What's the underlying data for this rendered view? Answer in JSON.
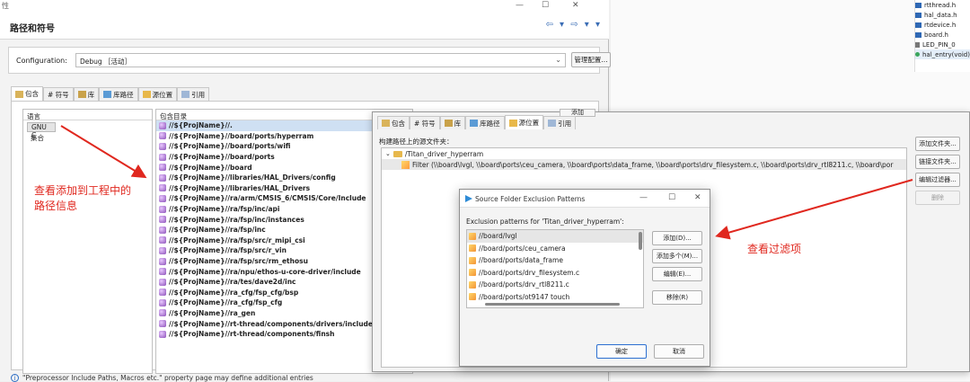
{
  "main_window": {
    "title_fragment": "性",
    "page_title": "路径和符号",
    "nav": "⇦ ▾ ⇨ ▾ ▾",
    "window_buttons": {
      "minimize": "—",
      "maximize": "☐",
      "close": "✕"
    }
  },
  "configuration": {
    "label": "Configuration:",
    "value": "Debug ［活动］",
    "manage_button": "管理配置..."
  },
  "main_tabs": [
    {
      "label": "包含",
      "icon": "include-icon",
      "active": true
    },
    {
      "label": "# 符号",
      "icon": "symbol-icon"
    },
    {
      "label": "库",
      "icon": "library-icon"
    },
    {
      "label": "库路径",
      "icon": "library-path-icon"
    },
    {
      "label": "源位置",
      "icon": "source-location-icon"
    },
    {
      "label": "引用",
      "icon": "reference-icon"
    }
  ],
  "language_panel": {
    "header": "语言",
    "items": [
      "GNU C",
      "集合"
    ]
  },
  "include_panel": {
    "header": "包含目录",
    "rows": [
      "//${ProjName}//.",
      "//${ProjName}//board/ports/hyperram",
      "//${ProjName}//board/ports/wifi",
      "//${ProjName}//board/ports",
      "//${ProjName}//board",
      "//${ProjName}//libraries/HAL_Drivers/config",
      "//${ProjName}//libraries/HAL_Drivers",
      "//${ProjName}//ra/arm/CMSIS_6/CMSIS/Core/Include",
      "//${ProjName}//ra/fsp/inc/api",
      "//${ProjName}//ra/fsp/inc/instances",
      "//${ProjName}//ra/fsp/inc",
      "//${ProjName}//ra/fsp/src/r_mipi_csi",
      "//${ProjName}//ra/fsp/src/r_vin",
      "//${ProjName}//ra/fsp/src/rm_ethosu",
      "//${ProjName}//ra/npu/ethos-u-core-driver/include",
      "//${ProjName}//ra/tes/dave2d/inc",
      "//${ProjName}//ra_cfg/fsp_cfg/bsp",
      "//${ProjName}//ra_cfg/fsp_cfg",
      "//${ProjName}//ra_gen",
      "//${ProjName}//rt-thread/components/drivers/include",
      "//${ProjName}//rt-thread/components/finsh"
    ],
    "add_button_partial": "添加"
  },
  "annotation_left": "查看添加到工程中的路径信息",
  "status_line": "\"Preprocessor Include Paths, Macros etc.\" property page may define additional entries",
  "outline": {
    "items": [
      "rtthread.h",
      "hal_data.h",
      "rtdevice.h",
      "board.h",
      "LED_PIN_0",
      "hal_entry(void)"
    ]
  },
  "props_window": {
    "tabs": [
      "包含",
      "# 符号",
      "库",
      "库路径",
      "源位置",
      "引用"
    ],
    "source_label": "构建路径上的源文件夹：",
    "folder": "/Titan_driver_hyperram",
    "filter": "Filter (\\\\board\\lvgl, \\\\board\\ports\\ceu_camera, \\\\board\\ports\\data_frame, \\\\board\\ports\\drv_filesystem.c, \\\\board\\ports\\drv_rtl8211.c, \\\\board\\por",
    "buttons": [
      "添加文件夹...",
      "链接文件夹...",
      "编辑过滤器...",
      "删除"
    ]
  },
  "annotation_right": "查看过滤项",
  "dialog": {
    "title": "Source Folder Exclusion Patterns",
    "description": "Exclusion patterns for 'Titan_driver_hyperram':",
    "patterns": [
      "//board/lvgl",
      "//board/ports/ceu_camera",
      "//board/ports/data_frame",
      "//board/ports/drv_filesystem.c",
      "//board/ports/drv_rtl8211.c",
      "//board/ports/ot9147 touch"
    ],
    "side_buttons": [
      "添加(D)...",
      "添加多个(M)...",
      "编辑(E)...",
      "移除(R)"
    ],
    "ok": "确定",
    "cancel": "取消"
  },
  "colors": {
    "annotation": "#e0281f",
    "selection": "#cfe0f3",
    "accent": "#2c6fd1"
  }
}
